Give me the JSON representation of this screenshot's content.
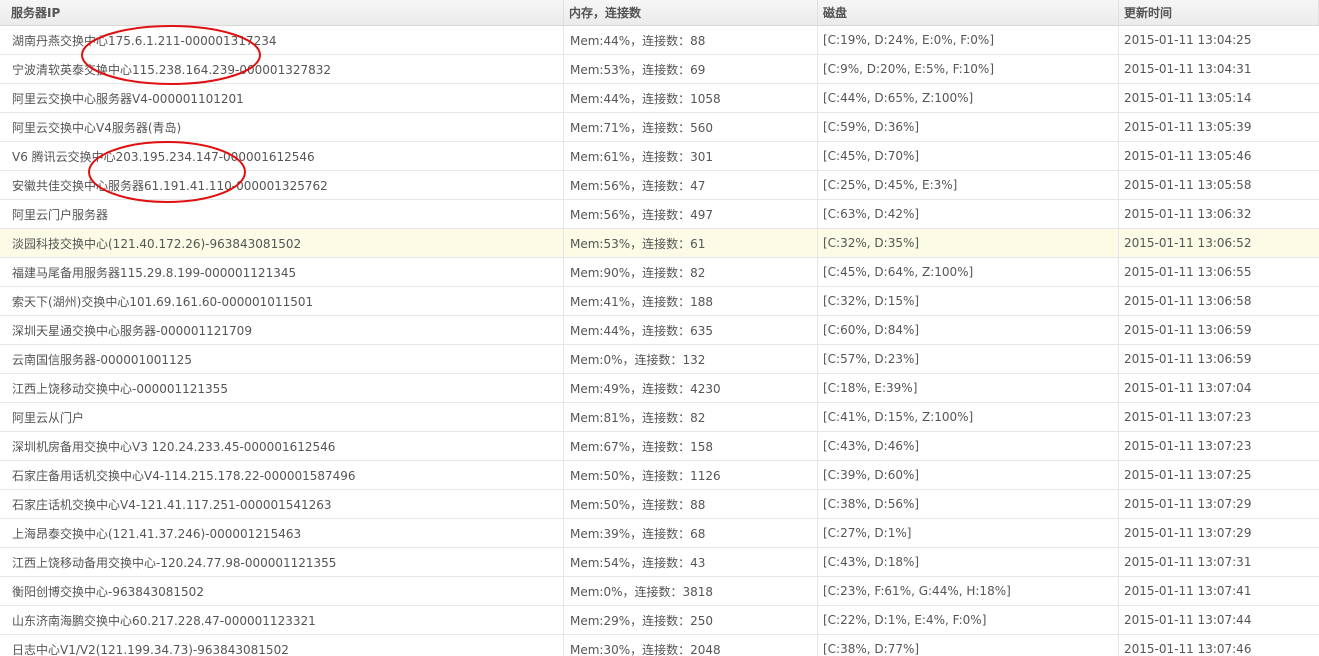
{
  "table": {
    "headers": {
      "server_ip": "服务器IP",
      "memory": "内存，连接数",
      "disk": "磁盘",
      "updated": "更新时间"
    },
    "highlight_color": "#fbfbe6",
    "rows": [
      {
        "server": "湖南丹燕交换中心175.6.1.211-000001317234",
        "mem": "Mem:44%，连接数：88",
        "disk": "[C:19%, D:24%, E:0%, F:0%]",
        "time": "2015-01-11 13:04:25"
      },
      {
        "server": "宁波清软英泰交换中心115.238.164.239-000001327832",
        "mem": "Mem:53%，连接数：69",
        "disk": "[C:9%, D:20%, E:5%, F:10%]",
        "time": "2015-01-11 13:04:31"
      },
      {
        "server": "阿里云交换中心服务器V4-000001101201",
        "mem": "Mem:44%，连接数：1058",
        "disk": "[C:44%, D:65%, Z:100%]",
        "time": "2015-01-11 13:05:14"
      },
      {
        "server": "阿里云交换中心V4服务器(青岛)",
        "mem": "Mem:71%，连接数：560",
        "disk": "[C:59%, D:36%]",
        "time": "2015-01-11 13:05:39"
      },
      {
        "server": "V6 腾讯云交换中心203.195.234.147-000001612546",
        "mem": "Mem:61%，连接数：301",
        "disk": "[C:45%, D:70%]",
        "time": "2015-01-11 13:05:46"
      },
      {
        "server": "安徽共佳交换中心服务器61.191.41.110-000001325762",
        "mem": "Mem:56%，连接数：47",
        "disk": "[C:25%, D:45%, E:3%]",
        "time": "2015-01-11 13:05:58"
      },
      {
        "server": "阿里云门户服务器",
        "mem": "Mem:56%，连接数：497",
        "disk": "[C:63%, D:42%]",
        "time": "2015-01-11 13:06:32"
      },
      {
        "server": "淡园科技交换中心(121.40.172.26)-963843081502",
        "mem": "Mem:53%，连接数：61",
        "disk": "[C:32%, D:35%]",
        "time": "2015-01-11 13:06:52",
        "highlight": true
      },
      {
        "server": "福建马尾备用服务器115.29.8.199-000001121345",
        "mem": "Mem:90%，连接数：82",
        "disk": "[C:45%, D:64%, Z:100%]",
        "time": "2015-01-11 13:06:55"
      },
      {
        "server": "索天下(湖州)交换中心101.69.161.60-000001011501",
        "mem": "Mem:41%，连接数：188",
        "disk": "[C:32%, D:15%]",
        "time": "2015-01-11 13:06:58"
      },
      {
        "server": "深圳天星通交换中心服务器-000001121709",
        "mem": "Mem:44%，连接数：635",
        "disk": "[C:60%, D:84%]",
        "time": "2015-01-11 13:06:59"
      },
      {
        "server": "云南国信服务器-000001001125",
        "mem": "Mem:0%，连接数：132",
        "disk": "[C:57%, D:23%]",
        "time": "2015-01-11 13:06:59"
      },
      {
        "server": "江西上饶移动交换中心-000001121355",
        "mem": "Mem:49%，连接数：4230",
        "disk": "[C:18%, E:39%]",
        "time": "2015-01-11 13:07:04"
      },
      {
        "server": "阿里云从门户",
        "mem": "Mem:81%，连接数：82",
        "disk": "[C:41%, D:15%, Z:100%]",
        "time": "2015-01-11 13:07:23"
      },
      {
        "server": "深圳机房备用交换中心V3 120.24.233.45-000001612546",
        "mem": "Mem:67%，连接数：158",
        "disk": "[C:43%, D:46%]",
        "time": "2015-01-11 13:07:23"
      },
      {
        "server": "石家庄备用话机交换中心V4-114.215.178.22-000001587496",
        "mem": "Mem:50%，连接数：1126",
        "disk": "[C:39%, D:60%]",
        "time": "2015-01-11 13:07:25"
      },
      {
        "server": "石家庄话机交换中心V4-121.41.117.251-000001541263",
        "mem": "Mem:50%，连接数：88",
        "disk": "[C:38%, D:56%]",
        "time": "2015-01-11 13:07:29"
      },
      {
        "server": "上海昂泰交换中心(121.41.37.246)-000001215463",
        "mem": "Mem:39%，连接数：68",
        "disk": "[C:27%, D:1%]",
        "time": "2015-01-11 13:07:29"
      },
      {
        "server": "江西上饶移动备用交换中心-120.24.77.98-000001121355",
        "mem": "Mem:54%，连接数：43",
        "disk": "[C:43%, D:18%]",
        "time": "2015-01-11 13:07:31"
      },
      {
        "server": "衡阳创博交换中心-963843081502",
        "mem": "Mem:0%，连接数：3818",
        "disk": "[C:23%, F:61%, G:44%, H:18%]",
        "time": "2015-01-11 13:07:41"
      },
      {
        "server": "山东济南海鹏交换中心60.217.228.47-000001123321",
        "mem": "Mem:29%，连接数：250",
        "disk": "[C:22%, D:1%, E:4%, F:0%]",
        "time": "2015-01-11 13:07:44"
      },
      {
        "server": "日志中心V1/V2(121.199.34.73)-963843081502",
        "mem": "Mem:30%，连接数：2048",
        "disk": "[C:38%, D:77%]",
        "time": "2015-01-11 13:07:46"
      }
    ]
  },
  "annotation_color": "#e01010"
}
